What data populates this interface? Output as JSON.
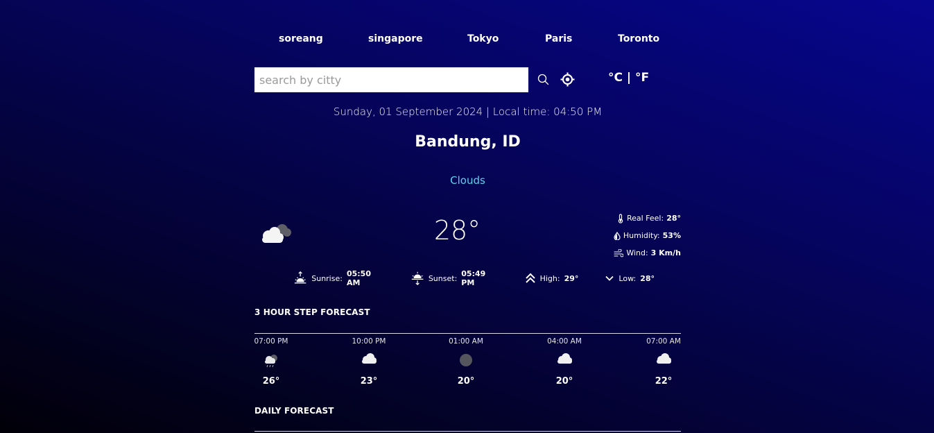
{
  "cities": [
    "soreang",
    "singapore",
    "Tokyo",
    "Paris",
    "Toronto"
  ],
  "search": {
    "value": "",
    "placeholder": "search by citty"
  },
  "icons": {
    "search": "search-icon",
    "location": "location-crosshair-icon"
  },
  "units": {
    "celsius": "°C",
    "separator": "|",
    "fahrenheit": "°F"
  },
  "datetime": "Sunday, 01 September 2024 | Local time: 04:50 PM",
  "location": "Bandung, ID",
  "condition": "Clouds",
  "temperature": "28°",
  "details": {
    "real_feel_label": "Real Feel:",
    "real_feel": "28°",
    "humidity_label": "Humidity:",
    "humidity": "53%",
    "wind_label": "Wind:",
    "wind": "3 Km/h"
  },
  "sun": {
    "sunrise_label": "Sunrise:",
    "sunrise": "05:50 AM",
    "sunset_label": "Sunset:",
    "sunset": "05:49 PM",
    "high_label": "High:",
    "high": "29°",
    "low_label": "Low:",
    "low": "28°"
  },
  "hourly_title": "3 HOUR STEP FORECAST",
  "hourly": [
    {
      "time": "07:00 PM",
      "temp": "26°",
      "icon": "rain-cloud-icon"
    },
    {
      "time": "10:00 PM",
      "temp": "23°",
      "icon": "cloud-icon"
    },
    {
      "time": "01:00 AM",
      "temp": "20°",
      "icon": "moon-icon"
    },
    {
      "time": "04:00 AM",
      "temp": "20°",
      "icon": "cloud-icon"
    },
    {
      "time": "07:00 AM",
      "temp": "22°",
      "icon": "cloud-icon"
    }
  ],
  "daily_title": "DAILY FORECAST",
  "colors": {
    "accent": "#5ad2ec",
    "background_top": "#07068f",
    "background_bottom": "#010008"
  }
}
